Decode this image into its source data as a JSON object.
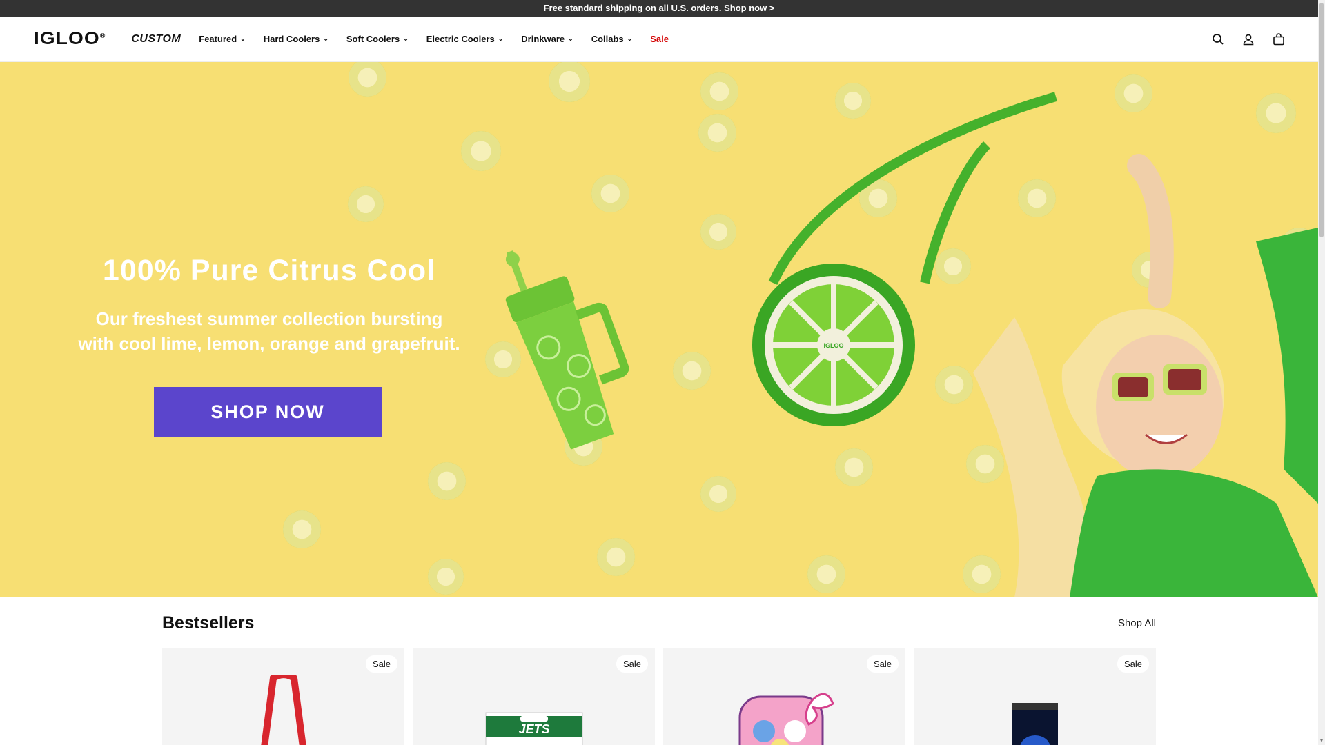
{
  "announcement": {
    "text": "Free standard shipping on all U.S. orders. Shop now >"
  },
  "header": {
    "logo": "IGLOO",
    "custom": "CUSTOM",
    "nav": [
      {
        "label": "Featured",
        "has_dropdown": true
      },
      {
        "label": "Hard Coolers",
        "has_dropdown": true
      },
      {
        "label": "Soft Coolers",
        "has_dropdown": true
      },
      {
        "label": "Electric Coolers",
        "has_dropdown": true
      },
      {
        "label": "Drinkware",
        "has_dropdown": true
      },
      {
        "label": "Collabs",
        "has_dropdown": true
      },
      {
        "label": "Sale",
        "has_dropdown": false,
        "color": "#d40000"
      }
    ],
    "icons": [
      "search-icon",
      "account-icon",
      "cart-icon"
    ]
  },
  "hero": {
    "title": "100% Pure Citrus Cool",
    "subtitle_line1": "Our freshest summer collection bursting",
    "subtitle_line2": "with cool lime, lemon, orange and grapefruit.",
    "button_label": "SHOP NOW",
    "button_color": "#5b45cc",
    "background_color": "#f7df73"
  },
  "bestsellers": {
    "title": "Bestsellers",
    "shop_all": "Shop All",
    "cards": [
      {
        "badge": "Sale",
        "image": "red-tote-bag"
      },
      {
        "badge": "Sale",
        "image": "jets-cooler-bag"
      },
      {
        "badge": "Sale",
        "image": "hello-kitty-lunch-bag"
      },
      {
        "badge": "Sale",
        "image": "blue-drink-can"
      }
    ]
  }
}
